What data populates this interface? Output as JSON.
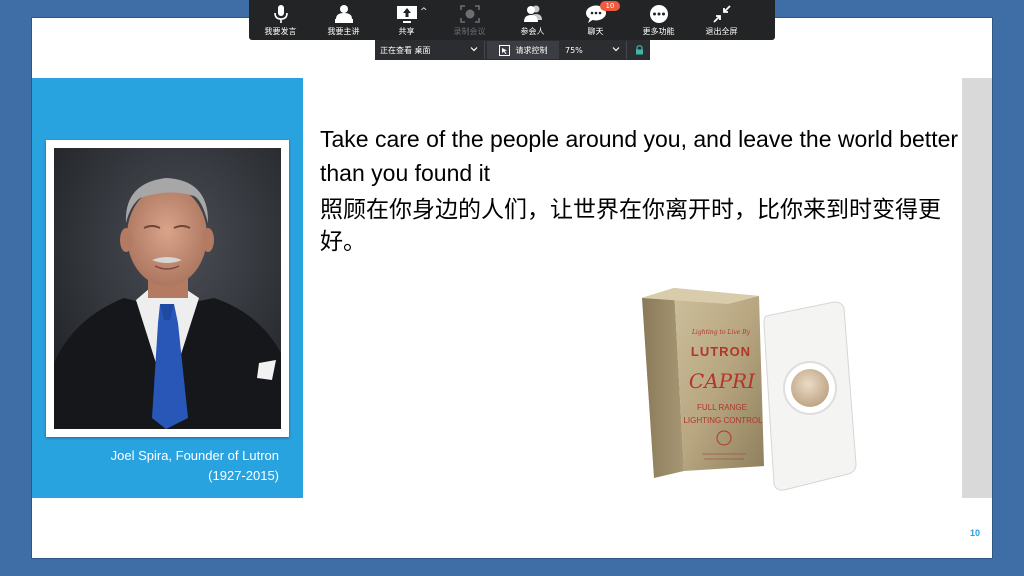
{
  "toolbar": {
    "buttons": [
      {
        "label": "我要发言",
        "icon": "microphone-icon"
      },
      {
        "label": "我要主讲",
        "icon": "presenter-icon"
      },
      {
        "label": "共享",
        "icon": "share-screen-icon"
      },
      {
        "label": "录制会议",
        "icon": "record-icon",
        "disabled": true
      },
      {
        "label": "参会人",
        "icon": "participants-icon"
      },
      {
        "label": "聊天",
        "icon": "chat-icon",
        "badge": "10"
      },
      {
        "label": "更多功能",
        "icon": "more-icon"
      },
      {
        "label": "退出全屏",
        "icon": "exit-fullscreen-icon"
      }
    ]
  },
  "control_strip": {
    "viewing_label": "正在查看 桌面",
    "remote_control_label": "请求控制",
    "zoom_level": "75%"
  },
  "slide": {
    "quote_en": "Take care of the people around you, and leave the world better than you found it",
    "quote_zh": "照顾在你身边的人们，让世界在你离开时，比你来到时变得更好。",
    "caption_name": "Joel Spira, Founder of Lutron",
    "caption_years": "(1927-2015)",
    "product_box_text": {
      "tagline": "Lighting to Live By",
      "brand": "LUTRON",
      "model": "CAPRI",
      "line1": "FULL RANGE",
      "line2": "LIGHTING CONTROL"
    },
    "page_number": "10"
  },
  "colors": {
    "accent_blue": "#29a3e0",
    "frame_blue": "#3f6ea6",
    "toolbar_bg": "#222426",
    "badge_red": "#ef5b3f"
  }
}
